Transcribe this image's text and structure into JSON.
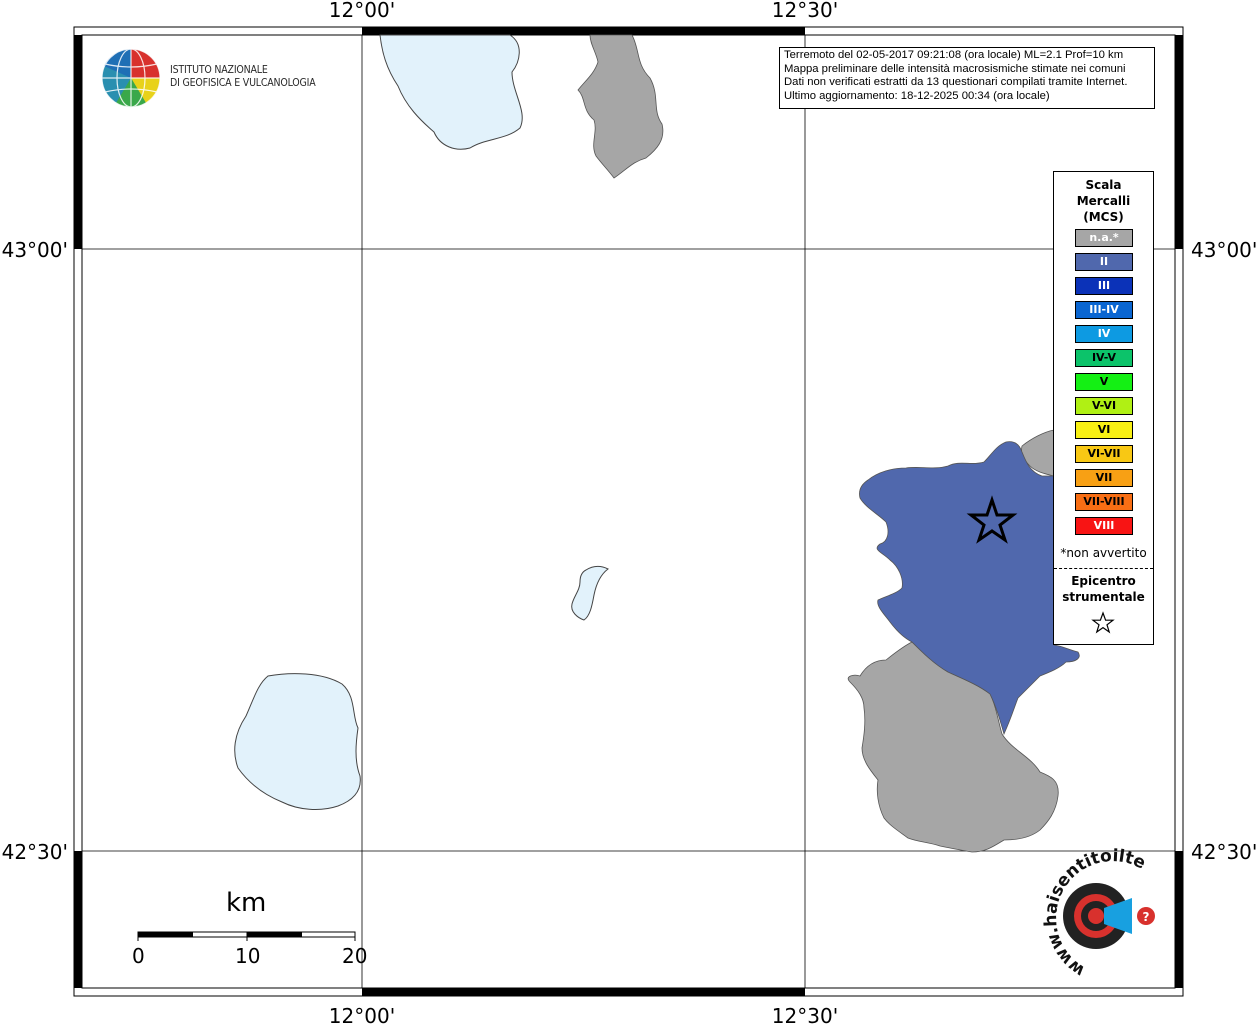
{
  "map": {
    "lon_labels": [
      "12°00'",
      "12°30'"
    ],
    "lat_labels": [
      "43°00'",
      "42°30'"
    ]
  },
  "logo_ingv": {
    "line1": "ISTITUTO NAZIONALE",
    "line2": "DI GEOFISICA E VULCANOLOGIA"
  },
  "info": {
    "line1": "Terremoto del 02-05-2017 09:21:08 (ora locale) ML=2.1 Prof=10 km",
    "line2": "Mappa preliminare delle intensità macrosismiche stimate nei comuni",
    "line3": "Dati non verificati estratti da 13 questionari compilati tramite Internet.",
    "line4": "Ultimo aggiornamento: 18-12-2025 00:34 (ora locale)"
  },
  "legend": {
    "title_line1": "Scala",
    "title_line2": "Mercalli",
    "title_line3": "(MCS)",
    "items": [
      {
        "label": "n.a.*",
        "color": "#a6a6a6",
        "text_color": "#ffffff"
      },
      {
        "label": "II",
        "color": "#5068ad",
        "text_color": "#ffffff"
      },
      {
        "label": "III",
        "color": "#0b32b8",
        "text_color": "#ffffff"
      },
      {
        "label": "III-IV",
        "color": "#0a66d2",
        "text_color": "#ffffff"
      },
      {
        "label": "IV",
        "color": "#0d9ae2",
        "text_color": "#ffffff"
      },
      {
        "label": "IV-V",
        "color": "#0cc36a",
        "text_color": "#000000"
      },
      {
        "label": "V",
        "color": "#14f014",
        "text_color": "#000000"
      },
      {
        "label": "V-VI",
        "color": "#b0f014",
        "text_color": "#000000"
      },
      {
        "label": "VI",
        "color": "#f8f014",
        "text_color": "#000000"
      },
      {
        "label": "VI-VII",
        "color": "#f8c814",
        "text_color": "#000000"
      },
      {
        "label": "VII",
        "color": "#f8a014",
        "text_color": "#000000"
      },
      {
        "label": "VII-VIII",
        "color": "#f86e14",
        "text_color": "#000000"
      },
      {
        "label": "VIII",
        "color": "#f81414",
        "text_color": "#ffffff"
      }
    ],
    "note": "*non avvertito",
    "epicenter_line1": "Epicentro",
    "epicenter_line2": "strumentale"
  },
  "scalebar": {
    "unit": "km",
    "ticks": [
      "0",
      "10",
      "20"
    ]
  },
  "logo_hsit": {
    "text": "www.haisentitoilterremoto.it"
  },
  "colors": {
    "lake": "#e2f2fb",
    "intensity_II": "#5068ad",
    "not_available": "#a6a6a6"
  }
}
